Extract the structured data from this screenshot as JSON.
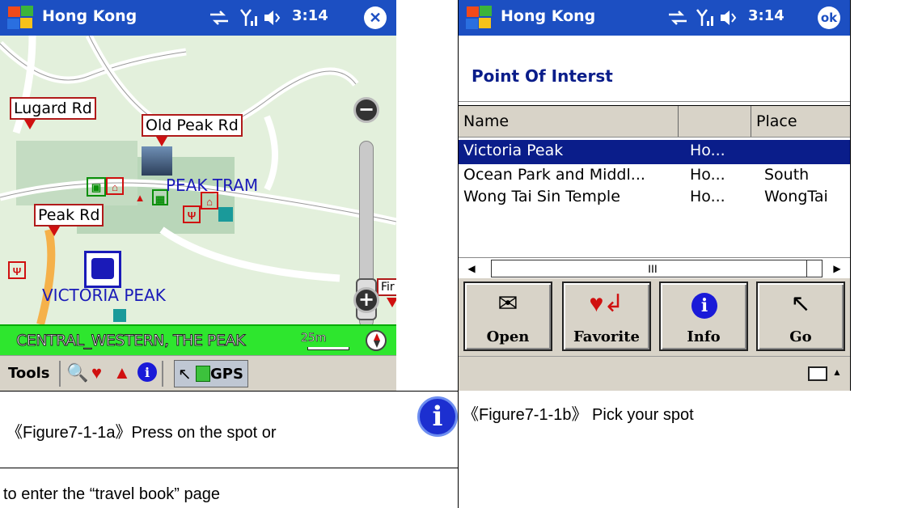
{
  "left_screen": {
    "title": "Hong Kong",
    "time": "3:14",
    "close_glyph": "✕",
    "map": {
      "road_labels": [
        "Lugard Rd",
        "Old Peak Rd",
        "Peak Rd"
      ],
      "place_labels": [
        "PEAK TRAM",
        "VICTORIA PEAK",
        "Fir"
      ],
      "zoom_out": "−",
      "zoom_in": "+"
    },
    "status_bar": {
      "location": "CENTRAL_WESTERN, THE PEAK",
      "scale": "25m"
    },
    "toolbar": {
      "tools_label": "Tools",
      "gps_label": "GPS"
    }
  },
  "right_screen": {
    "title": "Hong Kong",
    "time": "3:14",
    "ok_label": "ok",
    "header": "Point Of Interst",
    "columns": [
      "Name",
      "",
      "Place"
    ],
    "rows": [
      {
        "name": "Victoria Peak",
        "region": "Ho...",
        "place": ""
      },
      {
        "name": "Ocean Park and Middl...",
        "region": "Ho...",
        "place": "South"
      },
      {
        "name": "Wong Tai Sin Temple",
        "region": "Ho...",
        "place": "WongTai"
      }
    ],
    "selected_row": 0,
    "scroll_thumb": "III",
    "buttons": [
      {
        "label": "Open",
        "icon": "open-icon"
      },
      {
        "label": "Favorite",
        "icon": "favorite-icon"
      },
      {
        "label": "Info",
        "icon": "info-icon"
      },
      {
        "label": "Go",
        "icon": "go-cursor-icon"
      }
    ]
  },
  "captions": {
    "figure_a_line1": "《Figure7-1-1a》Press on the spot    or",
    "figure_a_line2": "to enter the “travel book” page",
    "figure_b": "《Figure7-1-1b》 Pick your spot",
    "info_glyph": "i"
  },
  "colors": {
    "titlebar": "#1c4fc2",
    "map_bg": "#e3f0dc",
    "status_green": "#2ee62e",
    "selection": "#0a1d8a",
    "toolbar_gray": "#d8d3c8"
  }
}
